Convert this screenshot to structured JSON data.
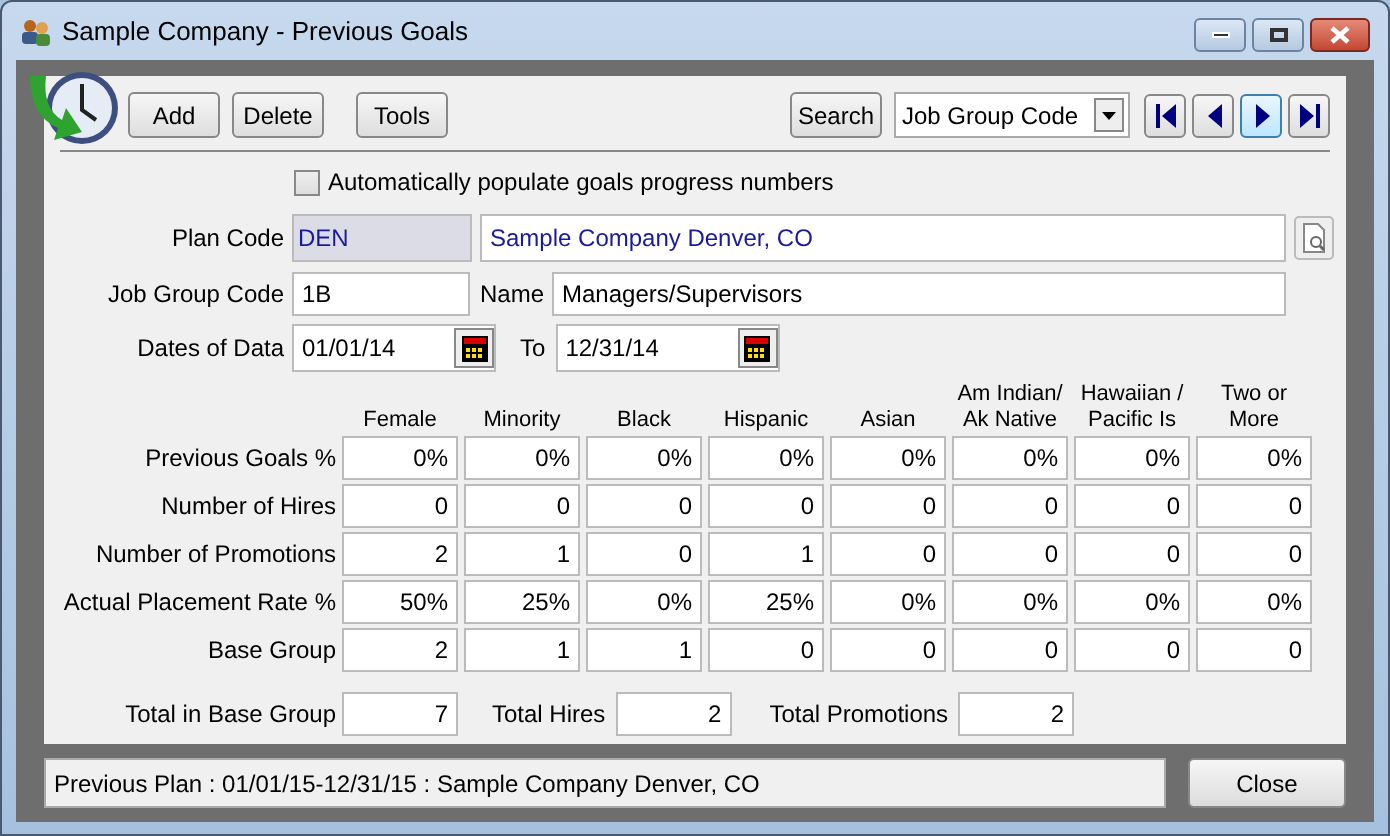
{
  "window": {
    "title": "Sample Company - Previous Goals"
  },
  "toolbar": {
    "buttons": [
      "Add",
      "Delete",
      "Tools"
    ],
    "search": "Search",
    "search_by": "Job Group Code",
    "nav": [
      {
        "kind": "first",
        "focused": false
      },
      {
        "kind": "prev",
        "focused": false
      },
      {
        "kind": "next",
        "focused": true
      },
      {
        "kind": "last",
        "focused": false
      }
    ]
  },
  "auto_populate": {
    "label": "Automatically populate goals progress numbers",
    "checked": false
  },
  "plan_code": {
    "label": "Plan Code",
    "value": "DEN",
    "description": "Sample Company Denver, CO"
  },
  "job_group": {
    "label": "Job Group Code",
    "value": "1B",
    "name_label": "Name",
    "name": "Managers/Supervisors"
  },
  "dates": {
    "label": "Dates of Data",
    "from": "01/01/14",
    "to_label": "To",
    "to": "12/31/14"
  },
  "grid": {
    "columns": [
      [
        "Female"
      ],
      [
        "Minority"
      ],
      [
        "Black"
      ],
      [
        "Hispanic"
      ],
      [
        "Asian"
      ],
      [
        "Am Indian/",
        "Ak Native"
      ],
      [
        "Hawaiian /",
        "Pacific Is"
      ],
      [
        "Two or",
        "More"
      ]
    ],
    "rows": [
      {
        "label": "Previous Goals %",
        "values": [
          "0%",
          "0%",
          "0%",
          "0%",
          "0%",
          "0%",
          "0%",
          "0%"
        ]
      },
      {
        "label": "Number of Hires",
        "values": [
          "0",
          "0",
          "0",
          "0",
          "0",
          "0",
          "0",
          "0"
        ]
      },
      {
        "label": "Number of Promotions",
        "values": [
          "2",
          "1",
          "0",
          "1",
          "0",
          "0",
          "0",
          "0"
        ]
      },
      {
        "label": "Actual Placement Rate %",
        "values": [
          "50%",
          "25%",
          "0%",
          "25%",
          "0%",
          "0%",
          "0%",
          "0%"
        ]
      },
      {
        "label": "Base Group",
        "values": [
          "2",
          "1",
          "1",
          "0",
          "0",
          "0",
          "0",
          "0"
        ]
      }
    ]
  },
  "totals": [
    {
      "label": "Total in Base Group",
      "value": "7"
    },
    {
      "label": "Total Hires",
      "value": "2"
    },
    {
      "label": "Total Promotions",
      "value": "2"
    }
  ],
  "status": "Previous Plan : 01/01/15-12/31/15 : Sample Company Denver, CO",
  "close": "Close"
}
